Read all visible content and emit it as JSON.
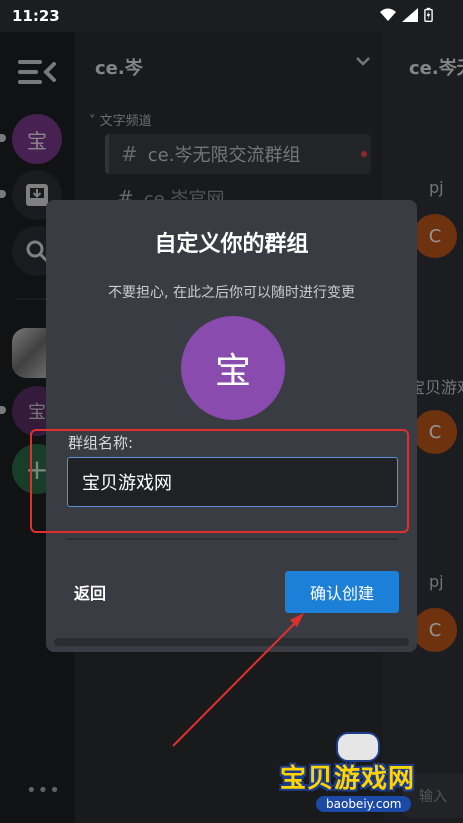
{
  "status_bar": {
    "time": "11:23"
  },
  "rail": {
    "server_initial": "宝",
    "server_initial_2": "宝",
    "add_symbol": "+",
    "more": "•••"
  },
  "channels": {
    "server_name": "ce.岑",
    "category": "文字频道",
    "items": [
      {
        "label": "ce.岑无限交流群组"
      },
      {
        "label": "ce.岑官网"
      }
    ]
  },
  "messages": {
    "channel_title": "ce.岑无",
    "tag_1": "pj",
    "tag_2": "宝贝游戏",
    "tag_3": "pj",
    "avatar_letter": "C",
    "input_placeholder": "输入"
  },
  "dialog": {
    "title": "自定义你的群组",
    "subtitle": "不要担心, 在此之后你可以随时进行变更",
    "avatar_text": "宝",
    "field_label": "群组名称:",
    "field_value": "宝贝游戏网",
    "back_label": "返回",
    "create_label": "确认创建"
  },
  "watermark": {
    "text": "宝贝游戏网",
    "url": "baobeiy.com"
  }
}
